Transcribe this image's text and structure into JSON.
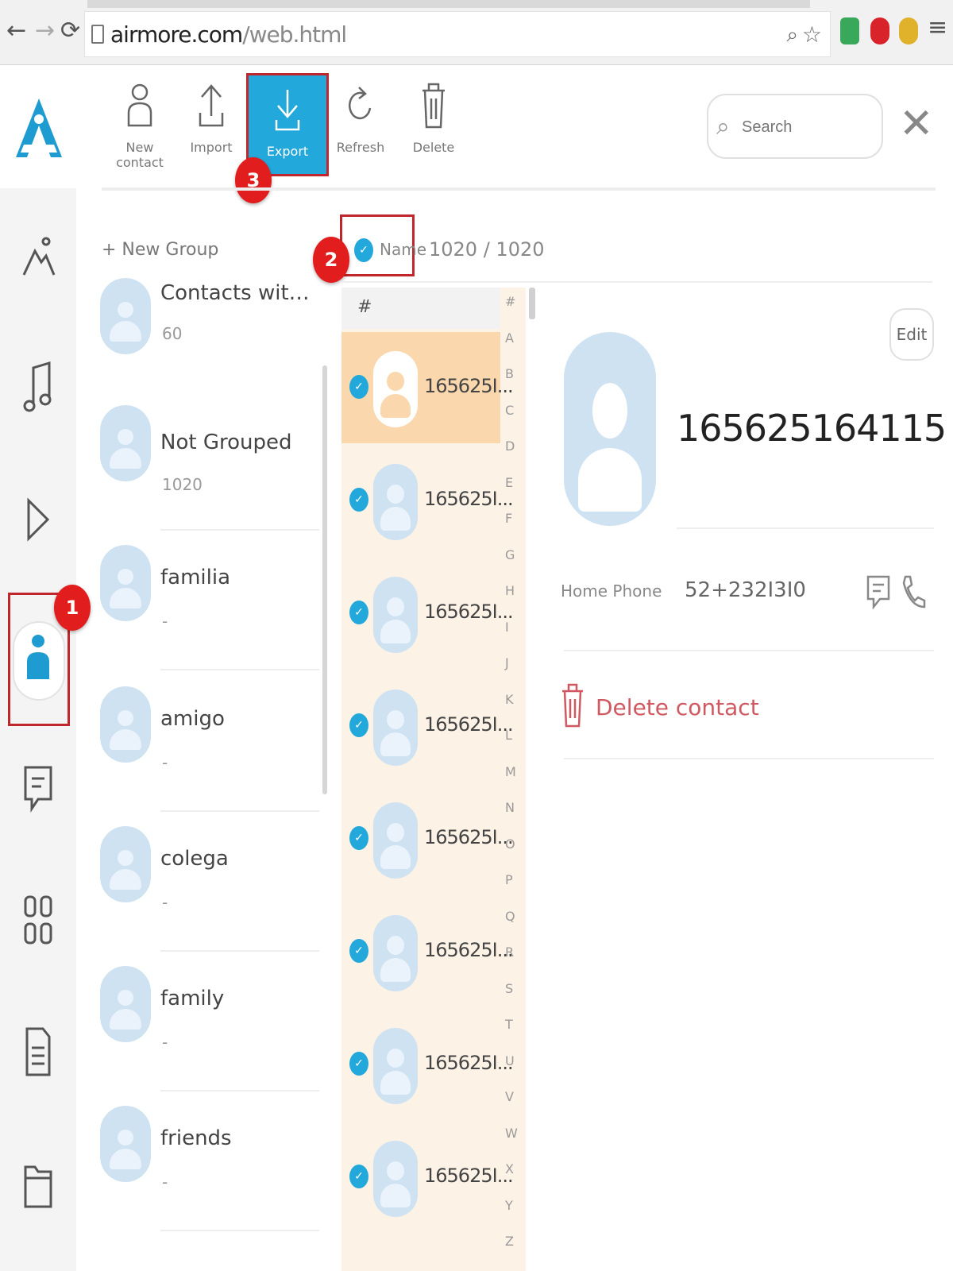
{
  "browser": {
    "url_host": "airmore.com",
    "url_path": "/web.html"
  },
  "toolbar": {
    "new_contact": "New contact",
    "import": "Import",
    "export": "Export",
    "refresh": "Refresh",
    "delete": "Delete",
    "search_placeholder": "Search",
    "close": "✕"
  },
  "steps": {
    "one": "1",
    "two": "2",
    "three": "3"
  },
  "groups": {
    "new_group": "+ New Group",
    "items": [
      {
        "name": "Contacts with Numb...",
        "count": "60"
      },
      {
        "name": "Not Grouped",
        "count": "1020"
      },
      {
        "name": "familia",
        "count": "-"
      },
      {
        "name": "amigo",
        "count": "-"
      },
      {
        "name": "colega",
        "count": "-"
      },
      {
        "name": "family",
        "count": "-"
      },
      {
        "name": "friends",
        "count": "-"
      }
    ]
  },
  "list": {
    "sort_label": "Name",
    "count": "1020 / 1020",
    "hash": "#",
    "contacts": [
      "165625I...",
      "165625I...",
      "165625I...",
      "165625I...",
      "165625I...",
      "165625I...",
      "165625I...",
      "165625I..."
    ],
    "alphabet": [
      "#",
      "A",
      "B",
      "C",
      "D",
      "E",
      "F",
      "G",
      "H",
      "I",
      "J",
      "K",
      "L",
      "M",
      "N",
      "O",
      "P",
      "Q",
      "R",
      "S",
      "T",
      "U",
      "V",
      "W",
      "X",
      "Y",
      "Z"
    ]
  },
  "detail": {
    "edit": "Edit",
    "name": "165625164115",
    "phone_label": "Home Phone",
    "phone_value": "52+232I3I0",
    "delete_contact": "Delete contact"
  },
  "colors": {
    "accent": "#22a8da",
    "marker_red": "#e21d1d",
    "highlight_border": "#c0272d",
    "selected_row": "#fad7ad",
    "list_bg": "#fdf2e6"
  }
}
